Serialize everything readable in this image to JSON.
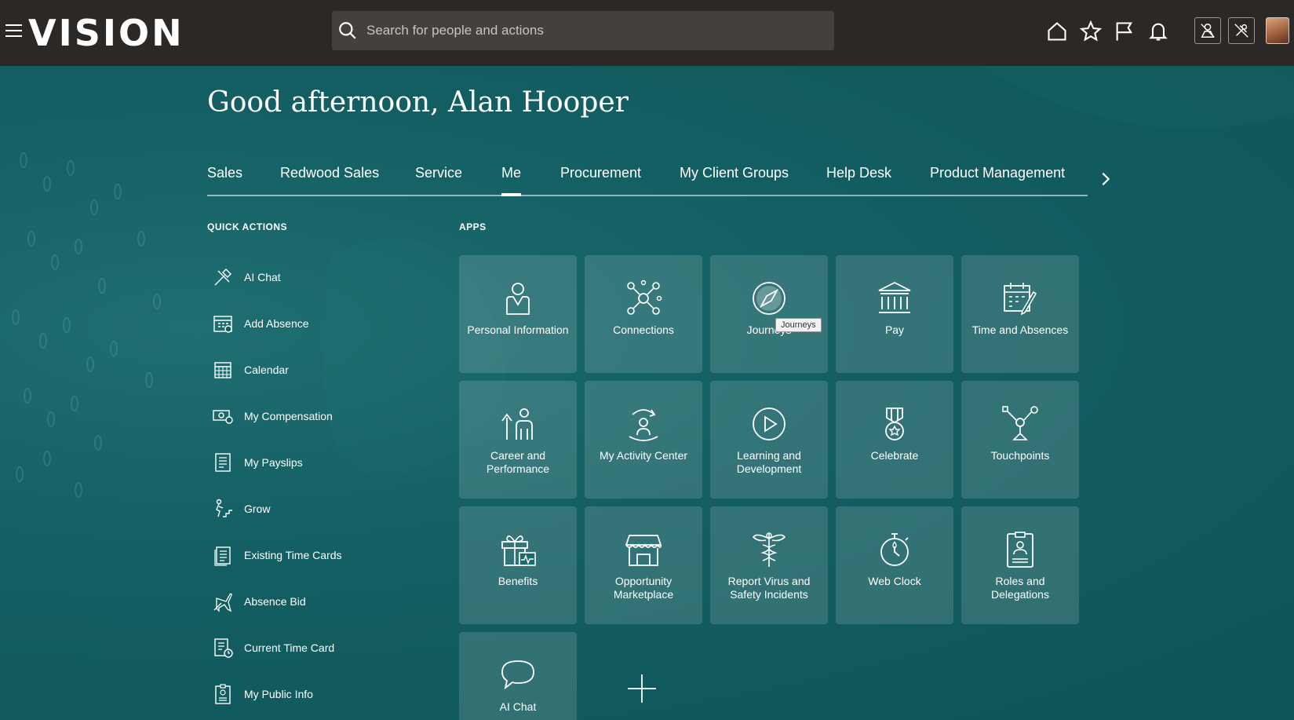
{
  "header": {
    "logo": "VISION",
    "search_placeholder": "Search for people and actions"
  },
  "greeting": "Good afternoon, Alan Hooper",
  "tabs": [
    {
      "label": "Sales"
    },
    {
      "label": "Redwood Sales"
    },
    {
      "label": "Service"
    },
    {
      "label": "Me",
      "active": true
    },
    {
      "label": "Procurement"
    },
    {
      "label": "My Client Groups"
    },
    {
      "label": "Help Desk"
    },
    {
      "label": "Product Management"
    }
  ],
  "quick_actions": {
    "title": "QUICK ACTIONS",
    "items": [
      {
        "label": "AI Chat",
        "icon": "ai-chat-tools-icon"
      },
      {
        "label": "Add Absence",
        "icon": "calendar-add-icon"
      },
      {
        "label": "Calendar",
        "icon": "calendar-icon"
      },
      {
        "label": "My Compensation",
        "icon": "compensation-icon"
      },
      {
        "label": "My Payslips",
        "icon": "payslip-icon"
      },
      {
        "label": "Grow",
        "icon": "grow-icon"
      },
      {
        "label": "Existing Time Cards",
        "icon": "time-cards-icon"
      },
      {
        "label": "Absence Bid",
        "icon": "airplane-icon"
      },
      {
        "label": "Current Time Card",
        "icon": "time-card-clock-icon"
      },
      {
        "label": "My Public Info",
        "icon": "public-info-icon"
      }
    ]
  },
  "apps": {
    "title": "APPS",
    "tiles": [
      {
        "label": "Personal Information",
        "icon": "person-icon"
      },
      {
        "label": "Connections",
        "icon": "connections-icon"
      },
      {
        "label": "Journeys",
        "icon": "compass-icon"
      },
      {
        "label": "Pay",
        "icon": "bank-icon"
      },
      {
        "label": "Time and Absences",
        "icon": "calendar-pen-icon"
      },
      {
        "label": "Career and Performance",
        "icon": "career-icon"
      },
      {
        "label": "My Activity Center",
        "icon": "activity-icon"
      },
      {
        "label": "Learning and Development",
        "icon": "play-icon"
      },
      {
        "label": "Celebrate",
        "icon": "medal-icon"
      },
      {
        "label": "Touchpoints",
        "icon": "touchpoints-icon"
      },
      {
        "label": "Benefits",
        "icon": "gift-icon"
      },
      {
        "label": "Opportunity Marketplace",
        "icon": "store-icon"
      },
      {
        "label": "Report Virus and Safety Incidents",
        "icon": "caduceus-icon"
      },
      {
        "label": "Web Clock",
        "icon": "stopwatch-icon"
      },
      {
        "label": "Roles and Delegations",
        "icon": "badge-icon"
      },
      {
        "label": "AI Chat",
        "icon": "chat-bubble-icon"
      }
    ],
    "tooltip": "Journeys"
  }
}
